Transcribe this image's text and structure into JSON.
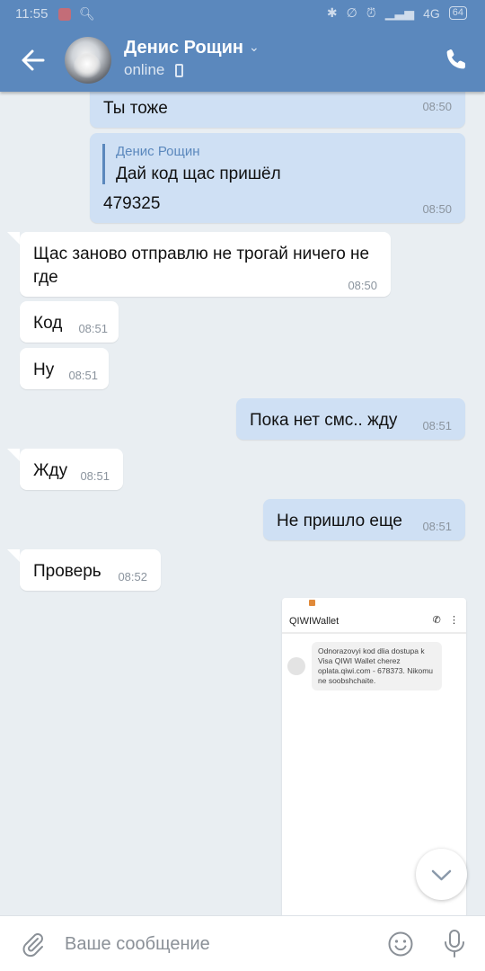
{
  "status_bar": {
    "time": "11:55",
    "network": "4G",
    "battery": "64"
  },
  "header": {
    "contact_name": "Денис Рощин",
    "contact_status": "online",
    "icons": [
      "back-arrow-icon",
      "chevron-down-icon",
      "mobile-icon",
      "phone-icon"
    ]
  },
  "messages": [
    {
      "dir": "out",
      "text": "Ты тоже",
      "time": "08:50"
    },
    {
      "dir": "out",
      "reply_to_name": "Денис Рощин",
      "reply_to_text": "Дай код щас пришёл",
      "text": "479325",
      "time": "08:50"
    },
    {
      "dir": "in",
      "text": "Щас заново отправлю не трогай ничего не где",
      "time": "08:50"
    },
    {
      "dir": "in",
      "text": "Код",
      "time": "08:51"
    },
    {
      "dir": "in",
      "text": "Ну",
      "time": "08:51"
    },
    {
      "dir": "out",
      "text": "Пока нет смс.. жду",
      "time": "08:51"
    },
    {
      "dir": "in",
      "text": "Жду",
      "time": "08:51"
    },
    {
      "dir": "out",
      "text": "Не пришло еще",
      "time": "08:51"
    },
    {
      "dir": "in",
      "text": "Проверь",
      "time": "08:52"
    }
  ],
  "attachment": {
    "app_title": "QIWIWallet",
    "sms_text": "Odnorazovyi kod dlia dostupa k Visa QIWI Wallet cherez oplata.qiwi.com - 678373. Nikomu ne soobshchaite."
  },
  "composer": {
    "placeholder": "Ваше сообщение"
  }
}
